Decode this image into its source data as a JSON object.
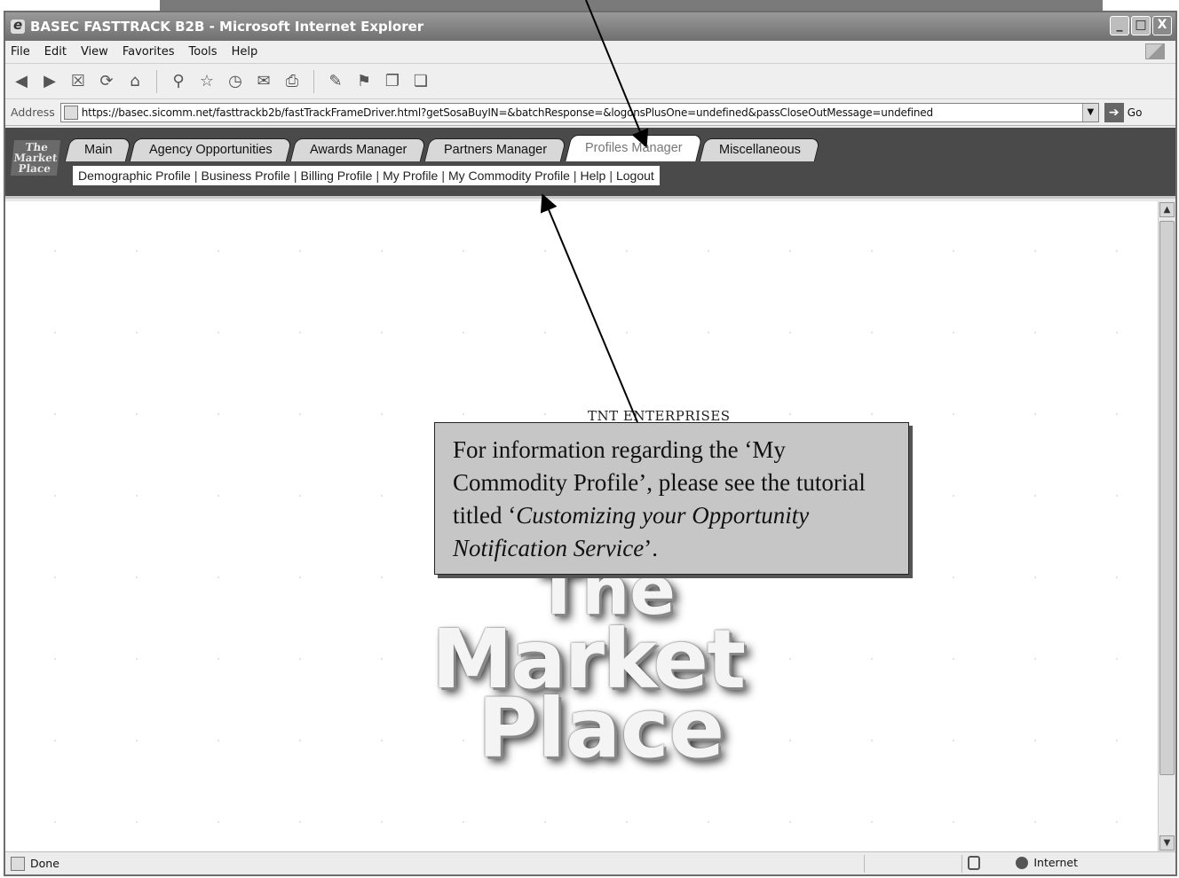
{
  "window": {
    "title": "BASEC FASTTRACK B2B - Microsoft Internet Explorer",
    "controls": [
      "_",
      "□",
      "X"
    ]
  },
  "menubar": {
    "items": [
      "File",
      "Edit",
      "View",
      "Favorites",
      "Tools",
      "Help"
    ]
  },
  "addressbar": {
    "label": "Address",
    "url": "https://basec.sicomm.net/fasttrackb2b/fastTrackFrameDriver.html?getSosaBuyIN=&batchResponse=&logonsPlusOne=undefined&passCloseOutMessage=undefined",
    "go_label": "Go"
  },
  "app": {
    "logo_text": [
      "The",
      "Market",
      "Place"
    ],
    "tabs": [
      {
        "label": "Main"
      },
      {
        "label": "Agency Opportunities"
      },
      {
        "label": "Awards Manager"
      },
      {
        "label": "Partners Manager"
      },
      {
        "label": "Profiles Manager",
        "active": true
      },
      {
        "label": "Miscellaneous"
      }
    ],
    "subnav": [
      "Demographic Profile",
      "Business Profile",
      "Billing Profile",
      "My Profile",
      "My Commodity Profile",
      "Help",
      "Logout"
    ]
  },
  "content": {
    "company": "TNT ENTERPRISES",
    "logo_lines": [
      "The",
      "Market",
      "Place"
    ]
  },
  "callout": {
    "text_before": "For information regarding the ‘My Commodity Profile’, please see the tutorial titled ‘",
    "italic": "Customizing your Opportunity Notification Service",
    "text_after": "’."
  },
  "statusbar": {
    "status": "Done",
    "zone": "Internet"
  }
}
